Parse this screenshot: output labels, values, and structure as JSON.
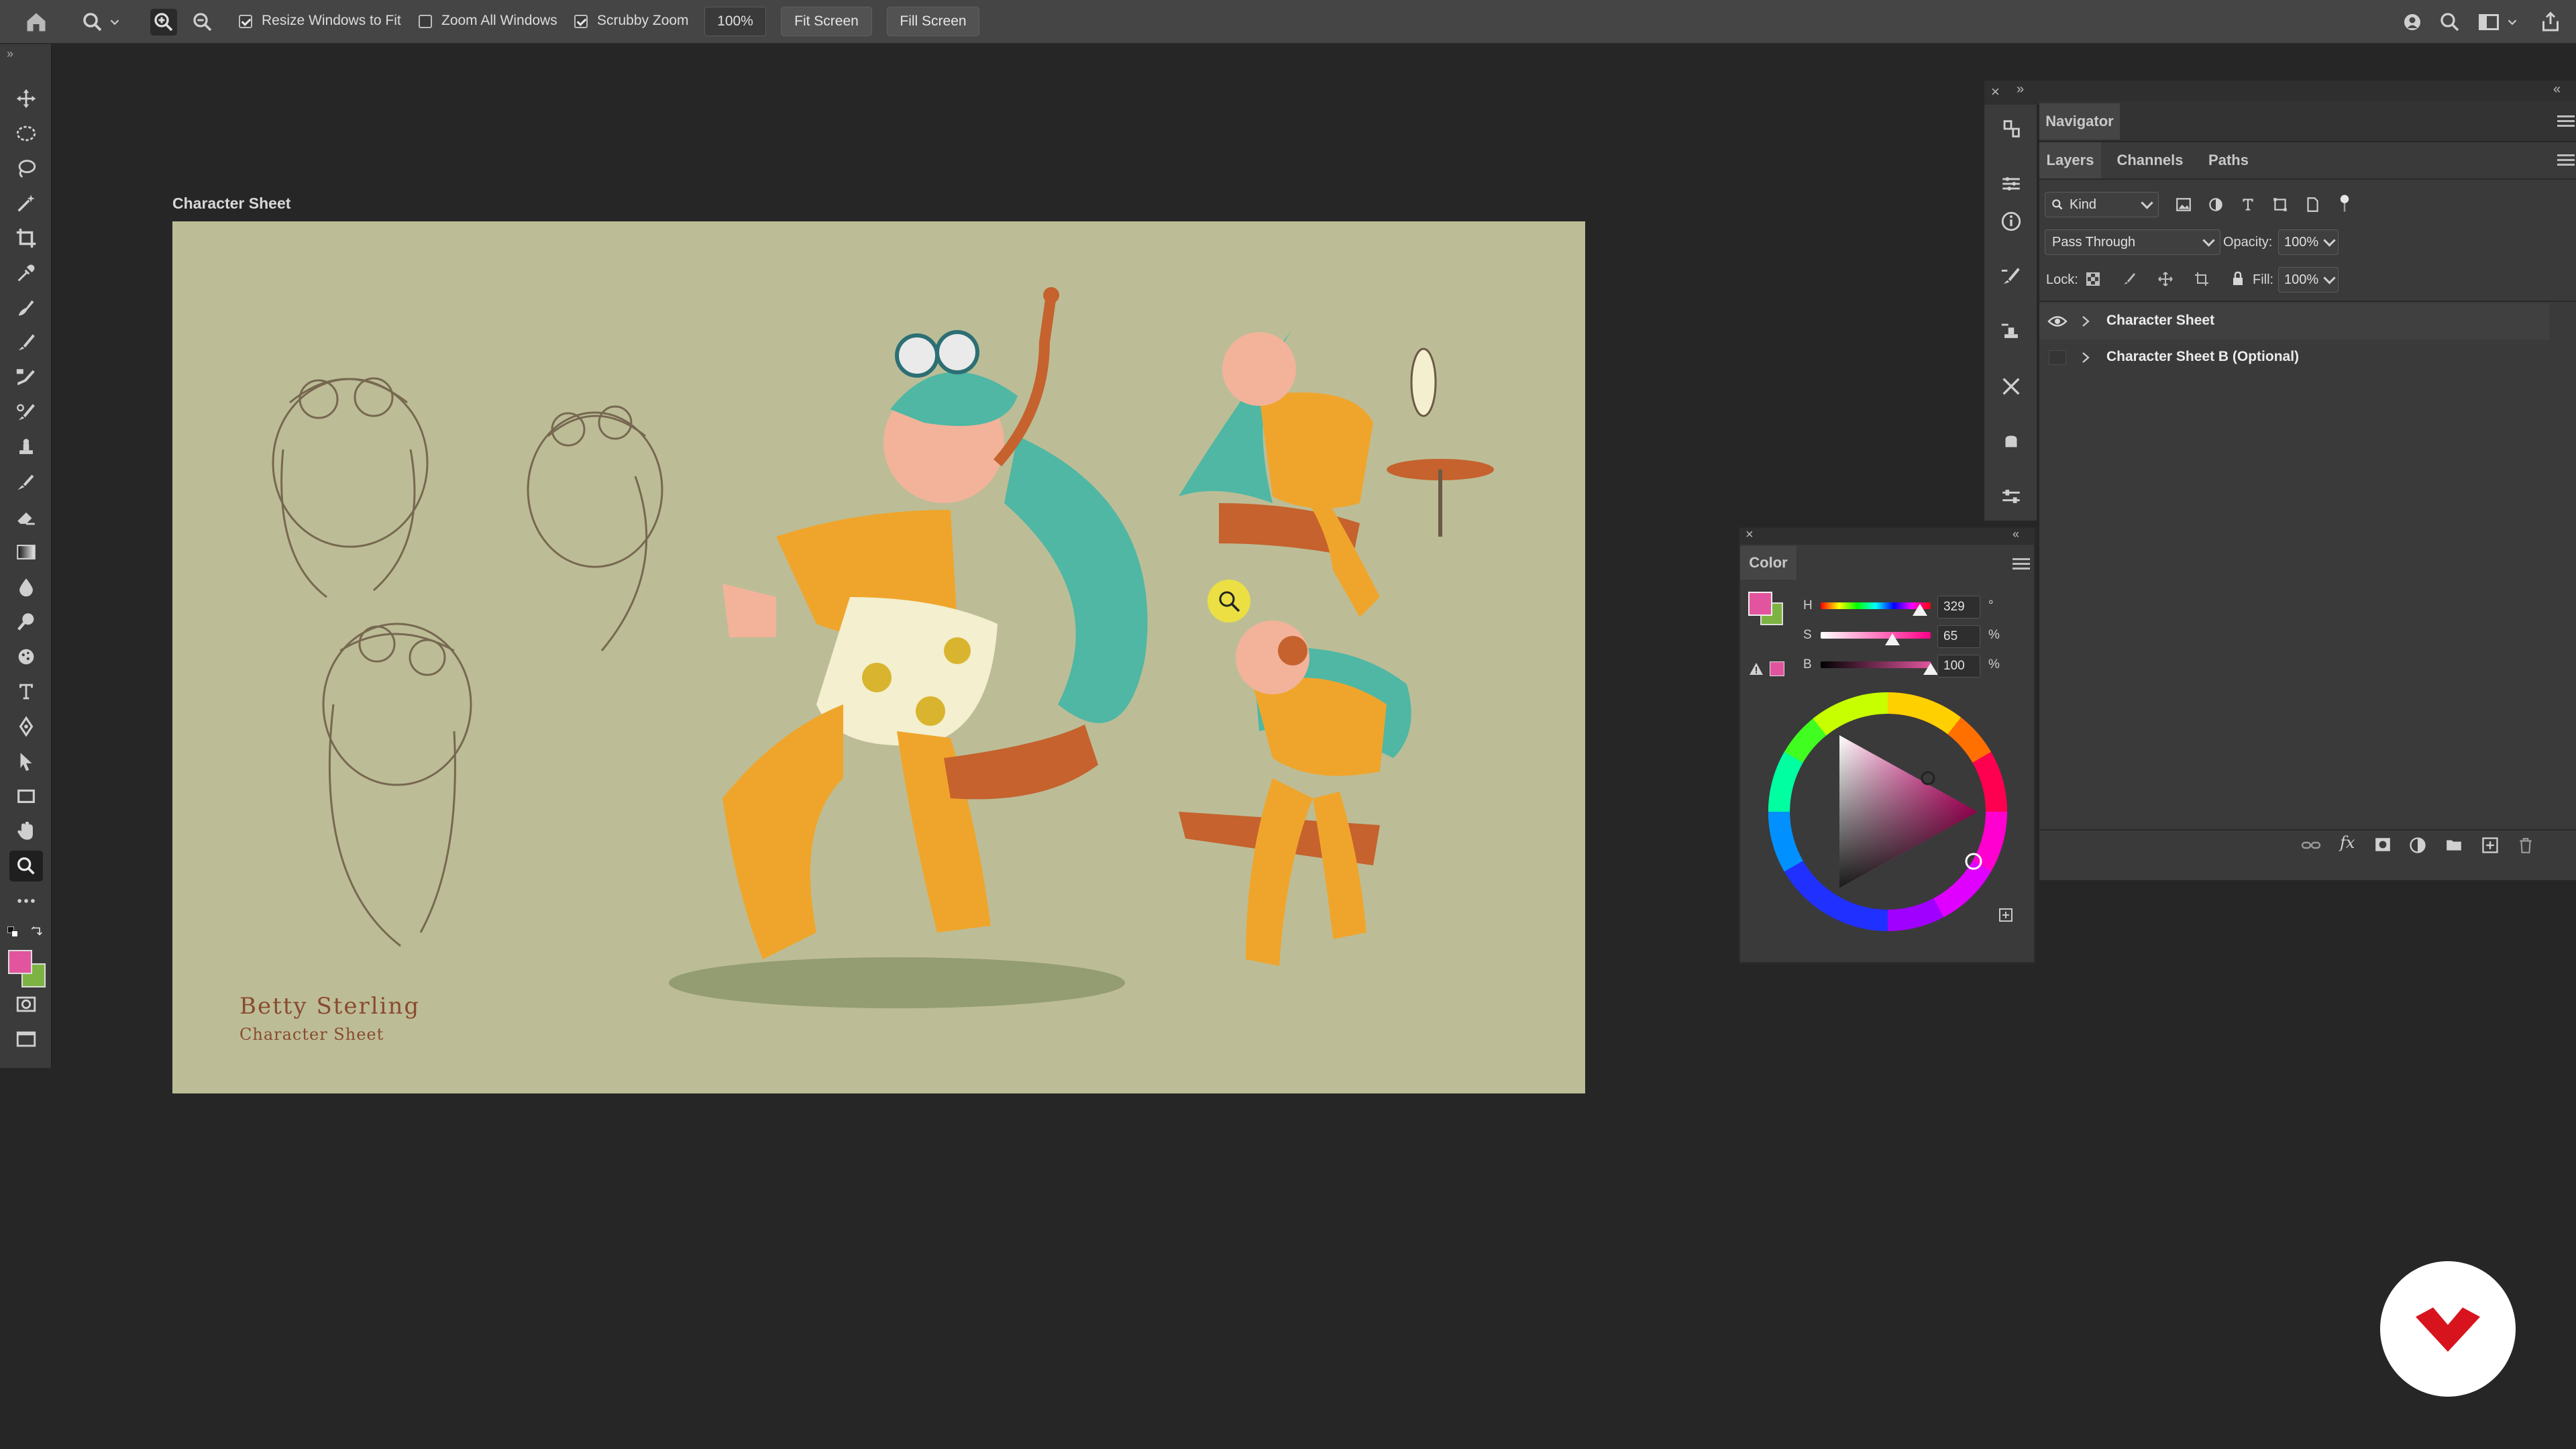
{
  "options_bar": {
    "resize_windows_label": "Resize Windows to Fit",
    "resize_windows_checked": true,
    "zoom_all_label": "Zoom All Windows",
    "zoom_all_checked": false,
    "scrubby_zoom_label": "Scrubby Zoom",
    "scrubby_zoom_checked": true,
    "zoom_level": "100%",
    "fit_screen_label": "Fit Screen",
    "fill_screen_label": "Fill Screen"
  },
  "document": {
    "title": "Character Sheet",
    "artwork": {
      "name": "Betty Sterling",
      "subtitle": "Character Sheet"
    }
  },
  "navigator": {
    "tab_label": "Navigator"
  },
  "layers": {
    "tabs": [
      "Layers",
      "Channels",
      "Paths"
    ],
    "active_tab": "Layers",
    "filter_kind": "Kind",
    "blend_mode": "Pass Through",
    "opacity_label": "Opacity:",
    "opacity_value": "100%",
    "lock_label": "Lock:",
    "fill_label": "Fill:",
    "fill_value": "100%",
    "items": [
      {
        "name": "Character Sheet",
        "visible": true
      },
      {
        "name": "Character Sheet B (Optional)",
        "visible": false
      }
    ]
  },
  "color_panel": {
    "title": "Color",
    "h_label": "H",
    "h_value": "329",
    "h_unit": "°",
    "s_label": "S",
    "s_value": "65",
    "s_unit": "%",
    "b_label": "B",
    "b_value": "100",
    "b_unit": "%",
    "foreground_color": "#e2559e",
    "background_color": "#7cb342"
  },
  "colors": {
    "accent_pink": "#e2559e",
    "brand_red": "#d7141e"
  },
  "icons": {
    "toolbar": [
      "move-icon",
      "marquee-icon",
      "lasso-icon",
      "magic-wand-icon",
      "crop-icon",
      "eyedropper-icon",
      "healing-brush-icon",
      "brush-icon",
      "clone-stamp-icon",
      "history-brush-icon",
      "eraser-icon",
      "gradient-icon",
      "blur-icon",
      "dodge-icon",
      "pen-icon",
      "type-icon",
      "path-selection-icon",
      "rectangle-icon",
      "hand-icon",
      "zoom-icon",
      "more-tools-icon"
    ]
  }
}
